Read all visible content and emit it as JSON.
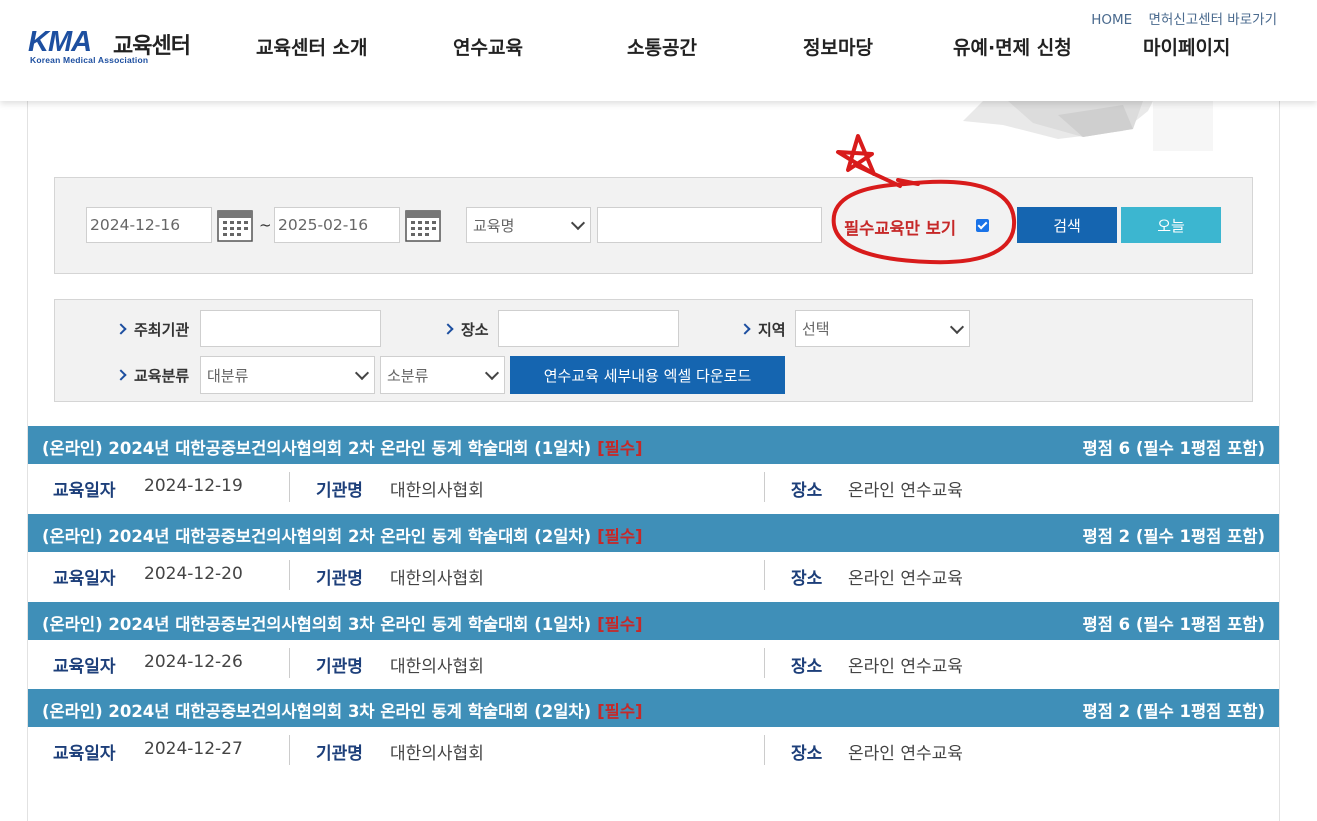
{
  "header": {
    "logo": {
      "kma": "KMA",
      "center": "교육센터",
      "sub": "Korean Medical Association"
    },
    "toplinks": [
      "HOME",
      "면허신고센터 바로가기"
    ],
    "nav": [
      "교육센터 소개",
      "연수교육",
      "소통공간",
      "정보마당",
      "유예·면제 신청",
      "마이페이지"
    ]
  },
  "search": {
    "date_from": "2024-12-16",
    "date_sep": "~",
    "date_to": "2025-02-16",
    "field_select": "교육명",
    "keyword": "",
    "required_only_label": "필수교육만 보기",
    "required_only_checked": true,
    "search_button": "검색",
    "today_button": "오늘"
  },
  "filters": {
    "host_label": "주최기관",
    "host_value": "",
    "place_label": "장소",
    "place_value": "",
    "region_label": "지역",
    "region_select": "선택",
    "category_label": "교육분류",
    "major_select": "대분류",
    "minor_select": "소분류",
    "excel_button": "연수교육 세부내용 엑셀 다운로드"
  },
  "results": [
    {
      "title": "(온라인) 2024년 대한공중보건의사협의회 2차 온라인 동계 학술대회 (1일차)",
      "required": "[필수]",
      "score": "평점 6 (필수 1평점 포함)",
      "date_label": "교육일자",
      "date": "2024-12-19",
      "org_label": "기관명",
      "org": "대한의사협회",
      "place_label": "장소",
      "place": "온라인 연수교육"
    },
    {
      "title": "(온라인) 2024년 대한공중보건의사협의회 2차 온라인 동계 학술대회 (2일차)",
      "required": "[필수]",
      "score": "평점 2 (필수 1평점 포함)",
      "date_label": "교육일자",
      "date": "2024-12-20",
      "org_label": "기관명",
      "org": "대한의사협회",
      "place_label": "장소",
      "place": "온라인 연수교육"
    },
    {
      "title": "(온라인) 2024년 대한공중보건의사협의회 3차 온라인 동계 학술대회 (1일차)",
      "required": "[필수]",
      "score": "평점 6 (필수 1평점 포함)",
      "date_label": "교육일자",
      "date": "2024-12-26",
      "org_label": "기관명",
      "org": "대한의사협회",
      "place_label": "장소",
      "place": "온라인 연수교육"
    },
    {
      "title": "(온라인) 2024년 대한공중보건의사협의회 3차 온라인 동계 학술대회 (2일차)",
      "required": "[필수]",
      "score": "평점 2 (필수 1평점 포함)",
      "date_label": "교육일자",
      "date": "2024-12-27",
      "org_label": "기관명",
      "org": "대한의사협회",
      "place_label": "장소",
      "place": "온라인 연수교육"
    }
  ],
  "colors": {
    "brand": "#1d4fa0",
    "row_header": "#3f8fb8",
    "search_button": "#1565b0",
    "today_button": "#3cb6d0",
    "required": "#c62828",
    "annotation": "#d81b1b"
  }
}
